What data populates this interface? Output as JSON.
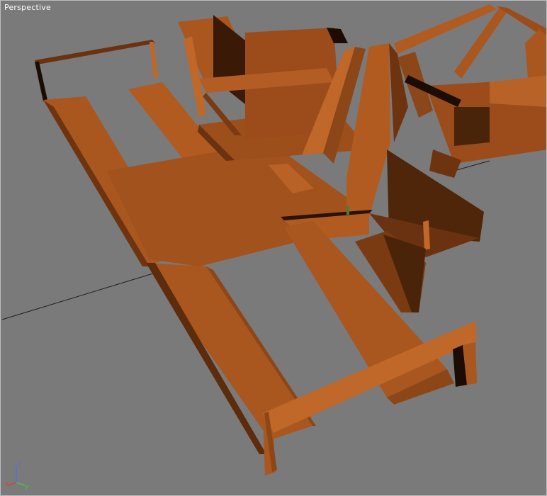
{
  "viewport": {
    "label": "Perspective",
    "background": "#7a7a7a",
    "material_colors": {
      "lit": "#a9561f",
      "mid": "#8c4719",
      "highlight": "#c0672a",
      "shadow": "#4a2409",
      "edge": "#2a1205"
    }
  },
  "axis_tripod": {
    "x_label": "x",
    "y_label": "y",
    "z_label": "z",
    "x_color": "#e03a3a",
    "y_color": "#3bd23b",
    "z_color": "#4a6cff"
  }
}
